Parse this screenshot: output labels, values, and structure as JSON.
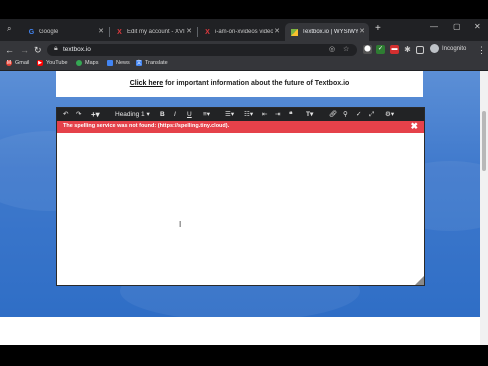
{
  "tabs": [
    {
      "title": "Google",
      "favicon": "google-icon"
    },
    {
      "title": "Edit my account - XVIDEOS",
      "favicon": "xvideos-icon"
    },
    {
      "title": "i-am-on-xvideos videos",
      "favicon": "xvideos-icon"
    },
    {
      "title": "Textbox.io | WYSIWYG HTML",
      "favicon": "textbox-icon"
    }
  ],
  "address": {
    "url": "textbox.io"
  },
  "profile": {
    "label": "Incognito"
  },
  "bookmarks": [
    {
      "label": "Gmail",
      "icon": "gmail-icon",
      "color": "#ea4335"
    },
    {
      "label": "YouTube",
      "icon": "youtube-icon",
      "color": "#ff0000"
    },
    {
      "label": "Maps",
      "icon": "maps-icon",
      "color": "#34a853"
    },
    {
      "label": "News",
      "icon": "news-icon",
      "color": "#4285f4"
    },
    {
      "label": "Translate",
      "icon": "translate-icon",
      "color": "#4285f4"
    }
  ],
  "notice": {
    "link": "Click here",
    "text": " for important information about the future of Textbox.io"
  },
  "editor": {
    "heading_select": "Heading 1",
    "error_message": "The spelling service was not found: (https://spelling.tiny.cloud).",
    "error_close": "✖"
  },
  "colors": {
    "error": "#e5414a",
    "toolbar": "#222325",
    "hero": "#3f79cc"
  }
}
